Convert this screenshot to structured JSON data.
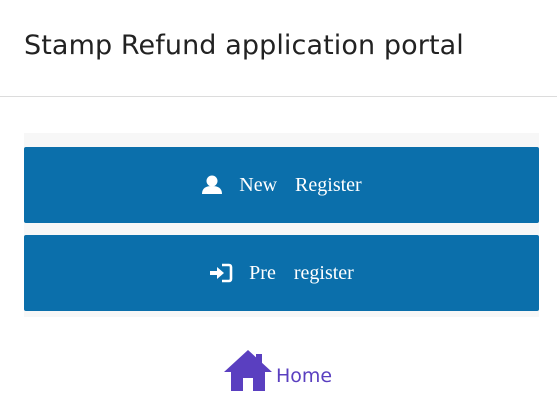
{
  "header": {
    "title": "Stamp Refund application portal"
  },
  "actions": {
    "new_register": {
      "word1": "New",
      "word2": "Register",
      "icon": "user-icon"
    },
    "pre_register": {
      "word1": "Pre",
      "word2": "register",
      "icon": "sign-in-icon"
    }
  },
  "footer": {
    "home_label": "Home",
    "home_icon": "home-icon"
  },
  "colors": {
    "button_bg": "#0b6fab",
    "button_text": "#ffffff",
    "home_color": "#5a3fc0"
  }
}
